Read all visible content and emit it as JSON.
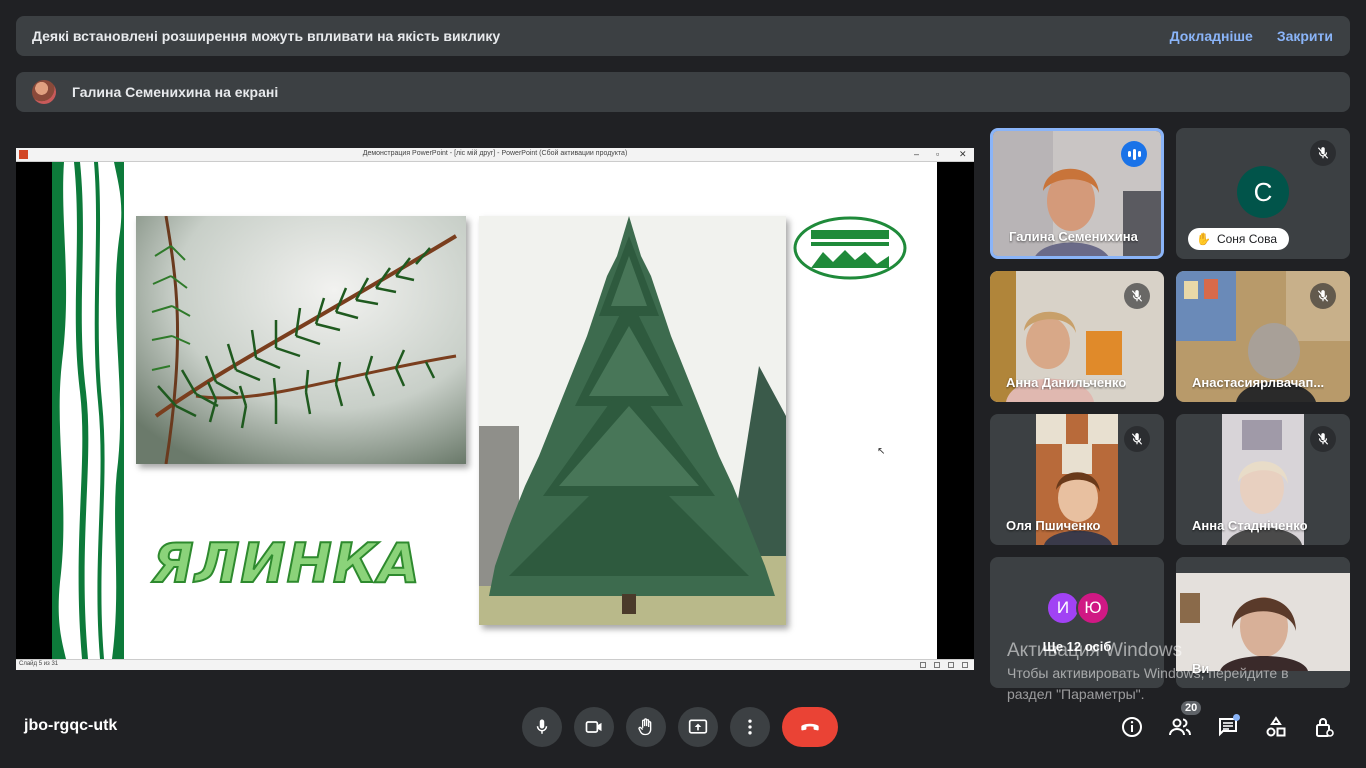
{
  "ext_banner": {
    "text": "Деякі встановлені розширення можуть впливати на якість виклику",
    "learn_more": "Докладніше",
    "close": "Закрити"
  },
  "share_banner": {
    "text": "Галина Семенихина на екрані"
  },
  "presentation": {
    "window_title": "Демонстрация PowerPoint - [лiс мiй друг] - PowerPoint (Сбой активации продукта)",
    "status_text": "Слайд 5 из 31",
    "slide_word": "ЯЛИНКА"
  },
  "participants": [
    {
      "name": "Галина Семенихина",
      "state": "speaking"
    },
    {
      "name": "Соня Сова",
      "initial": "С",
      "color": "#01544a",
      "state": "muted"
    },
    {
      "name": "Анна Данильченко",
      "state": "muted"
    },
    {
      "name": "Анастасиярлвачап...",
      "state": "muted"
    },
    {
      "name": "Оля Пшиченко",
      "state": "muted"
    },
    {
      "name": "Анна Стадніченко",
      "state": "muted"
    },
    {
      "more_label": "Ще 12 осіб",
      "initials": [
        "И",
        "Ю"
      ],
      "colors": [
        "#a142f4",
        "#d01884"
      ]
    },
    {
      "name": "Ви"
    }
  ],
  "activation": {
    "title": "Активация Windows",
    "line1": "Чтобы активировать Windows, перейдите в",
    "line2": "раздел \"Параметры\"."
  },
  "bottom_bar": {
    "meeting_code": "jbo-rgqc-utk",
    "people_count": "20",
    "controls": [
      "mic-icon",
      "camera-icon",
      "raise-hand-icon",
      "present-icon",
      "more-vert-icon",
      "end-call-icon"
    ],
    "right_controls": [
      "info-icon",
      "people-icon",
      "chat-icon",
      "activities-icon",
      "host-controls-icon"
    ]
  }
}
